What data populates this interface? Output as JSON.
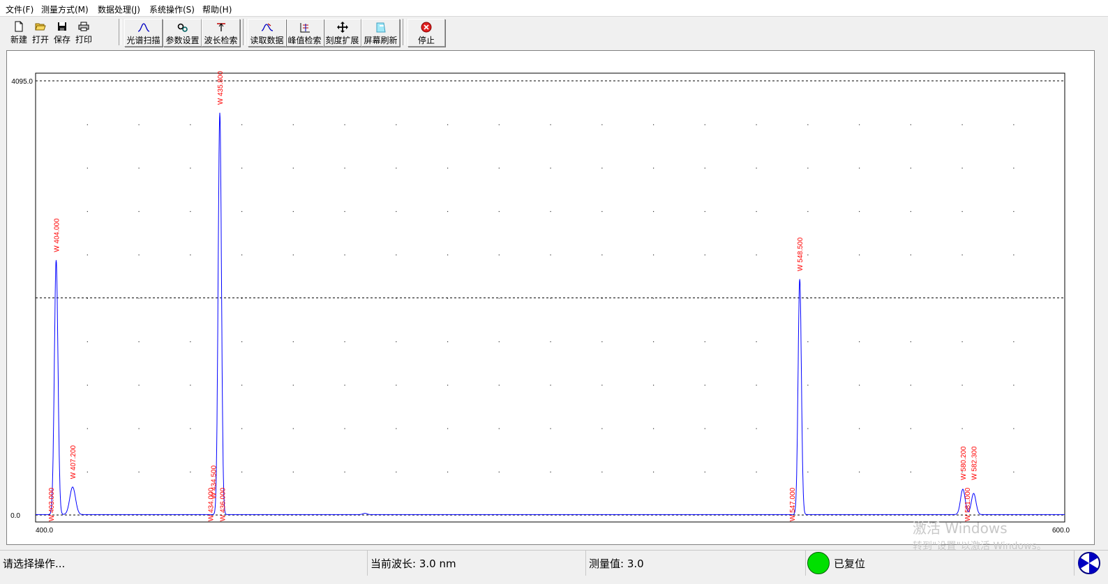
{
  "menu": [
    "文件(F)",
    "测量方式(M)",
    "数据处理(J)",
    "系统操作(S)",
    "帮助(H)"
  ],
  "toolbar": {
    "file": [
      "新建",
      "打开",
      "保存",
      "打印"
    ],
    "measure": [
      "光谱扫描",
      "参数设置",
      "波长检索"
    ],
    "data": [
      "读取数据",
      "峰值检索",
      "刻度扩展",
      "屏幕刷新"
    ],
    "stop": "停止"
  },
  "status": {
    "prompt": "请选择操作...",
    "wavelength": "当前波长: 3.0 nm",
    "measure_value": "测量值: 3.0",
    "state": "已复位"
  },
  "colors": {
    "spectrum": "#0000ff",
    "peak_label": "#ff0000",
    "led": "#00e000"
  },
  "watermark": {
    "line1": "激活 Windows",
    "line2": "转到\"设置\"以激活 Windows。"
  },
  "chart_data": {
    "type": "line",
    "xlim": [
      400.0,
      600.0
    ],
    "ylim": [
      0.0,
      4095.0
    ],
    "x_tick_labels": [
      "400.0",
      "600.0"
    ],
    "y_tick_labels": [
      "4095.0",
      "0.0"
    ],
    "reference_line_y": 2048,
    "series": [
      {
        "peaks": [
          {
            "x": 404.0,
            "height": 2400,
            "width": 0.35
          },
          {
            "x": 407.2,
            "height": 260,
            "width": 0.55
          },
          {
            "x": 435.8,
            "height": 3790,
            "width": 0.32
          },
          {
            "x": 548.5,
            "height": 2220,
            "width": 0.32
          },
          {
            "x": 580.2,
            "height": 240,
            "width": 0.45
          },
          {
            "x": 582.3,
            "height": 200,
            "width": 0.45
          }
        ]
      }
    ],
    "peak_labels": [
      {
        "text": "W 404.000",
        "x": 404.0,
        "y": 2480
      },
      {
        "text": "W 407.200",
        "x": 407.2,
        "y": 340
      },
      {
        "text": "W 435.800",
        "x": 435.8,
        "y": 3870
      },
      {
        "text": "W 548.500",
        "x": 548.5,
        "y": 2300
      },
      {
        "text": "W 580.200",
        "x": 580.2,
        "y": 330
      },
      {
        "text": "W 582.300",
        "x": 582.3,
        "y": 330
      },
      {
        "text": "W 403.000",
        "x": 403.0,
        "y": -60
      },
      {
        "text": "W 434.500",
        "x": 434.5,
        "y": 150
      },
      {
        "text": "W 434.000",
        "x": 434.0,
        "y": -60
      },
      {
        "text": "W 436.000",
        "x": 436.3,
        "y": -60
      },
      {
        "text": "W 547.000",
        "x": 547.0,
        "y": -60
      },
      {
        "text": "W 581.000",
        "x": 581.0,
        "y": -60
      }
    ]
  }
}
